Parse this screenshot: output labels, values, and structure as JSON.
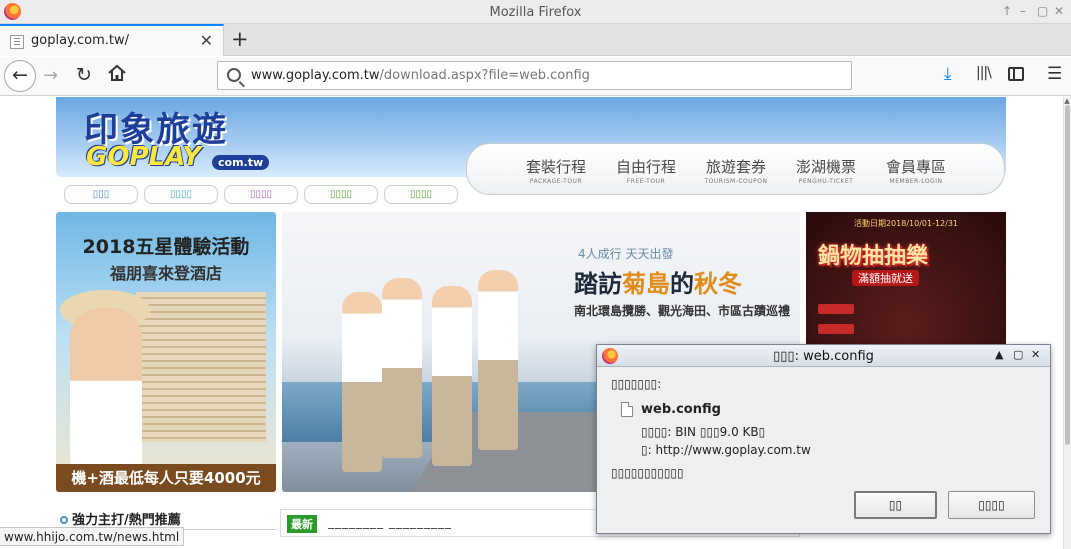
{
  "window": {
    "title": "Mozilla Firefox",
    "controls": [
      "↑",
      "–",
      "▢",
      "✕"
    ]
  },
  "tabbar": {
    "tab_label": "goplay.com.tw/",
    "close_glyph": "✕",
    "new_tab_glyph": "+"
  },
  "toolbar": {
    "url_host": "www.goplay.com.tw",
    "url_path": "/download.aspx?file=web.config",
    "icons": [
      "back-arrow-icon",
      "forward-arrow-icon",
      "reload-icon",
      "home-icon",
      "search-icon",
      "download-icon",
      "library-icon",
      "sidebar-icon",
      "hamburger-menu-icon"
    ]
  },
  "site": {
    "logo_cn": "印象旅遊",
    "logo_en": "GOPLAY",
    "logo_com": "com.tw",
    "menu": [
      {
        "cn": "套裝行程",
        "en": "PACKAGE-TOUR"
      },
      {
        "cn": "自由行程",
        "en": "FREE-TOUR"
      },
      {
        "cn": "旅遊套券",
        "en": "TOURISM-COUPON"
      },
      {
        "cn": "澎湖機票",
        "en": "PENGHU-TICKET"
      },
      {
        "cn": "會員專區",
        "en": "MEMBER-LOGIN"
      }
    ],
    "subtab_colors": [
      "#4a90c8",
      "#3fb3c4",
      "#b568b8",
      "#5aa73c",
      "#5aa73c"
    ],
    "promo_left": {
      "title": "2018五星體驗活動",
      "subtitle": "福朋喜來登酒店",
      "footer": "機+酒最低每人只要4000元"
    },
    "promo_center": {
      "tagline": "4人成行 天天出發",
      "headline_a": "踏訪",
      "headline_b": "菊島",
      "headline_c": "的",
      "headline_d": "秋冬",
      "subline": "南北環島攬勝、觀光海田、市區古蹟巡禮"
    },
    "promo_right": {
      "period": "活動日期2018/10/01-12/31",
      "title": "鍋物抽抽樂",
      "subtitle": "滿額抽就送"
    },
    "section_title": "強力主打/熱門推薦",
    "news_badge": "最新",
    "news_text": "________ _________"
  },
  "statusbar": {
    "url": "www.hhijo.com.tw/news.html"
  },
  "dialog": {
    "title_prefix": "▯▯▯",
    "title_file": ": web.config",
    "intro": "▯▯▯▯▯▯▯:",
    "filename": "web.config",
    "type_line": "▯▯▯▯: BIN ▯▯▯9.0 KB▯",
    "source_line": "▯: http://www.goplay.com.tw",
    "question": "▯▯▯▯▯▯▯▯▯▯▯",
    "btn_primary": "▯▯",
    "btn_secondary": "▯▯▯▯"
  }
}
